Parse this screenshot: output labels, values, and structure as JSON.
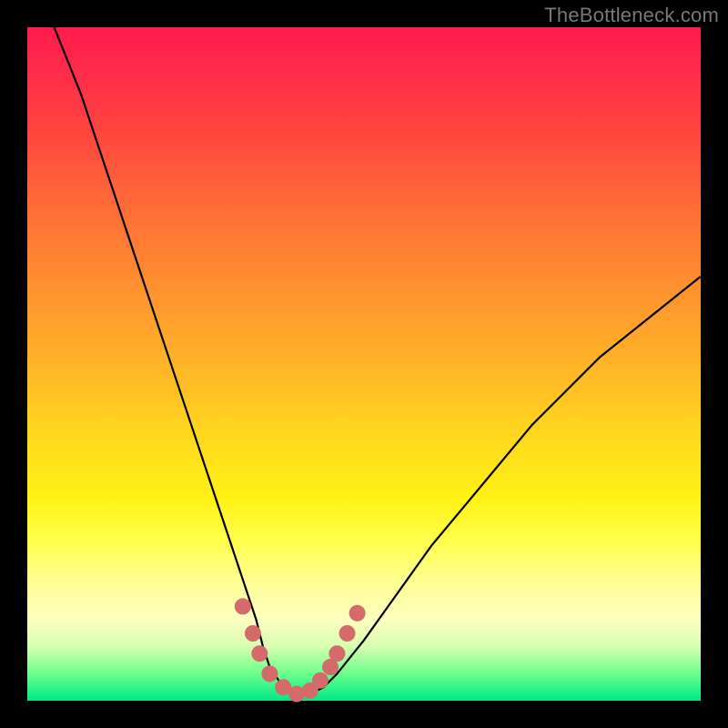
{
  "watermark": "TheBottleneck.com",
  "colors": {
    "frame": "#000000",
    "curve": "#000000",
    "marker": "#d46a6a",
    "gradient_top": "#ff1a4d",
    "gradient_bottom": "#00e887"
  },
  "chart_data": {
    "type": "line",
    "title": "",
    "xlabel": "",
    "ylabel": "",
    "xlim": [
      0,
      100
    ],
    "ylim": [
      0,
      100
    ],
    "annotations": [],
    "series": [
      {
        "name": "bottleneck-curve",
        "x": [
          4,
          8,
          12,
          16,
          20,
          24,
          28,
          30,
          32,
          34,
          35,
          36,
          38,
          40,
          42,
          44,
          46,
          50,
          55,
          60,
          65,
          70,
          75,
          80,
          85,
          90,
          95,
          100
        ],
        "y": [
          100,
          90,
          78,
          66,
          54,
          42,
          30,
          24,
          18,
          12,
          8,
          5,
          2,
          1,
          1,
          2,
          4,
          9,
          16,
          23,
          29,
          35,
          41,
          46,
          51,
          55,
          59,
          63
        ]
      }
    ],
    "markers": {
      "name": "highlight-dots",
      "x": [
        32,
        33.5,
        34.5,
        36,
        38,
        40,
        42,
        43.5,
        45,
        46,
        47.5,
        49
      ],
      "y": [
        14,
        10,
        7,
        4,
        2,
        1,
        1.5,
        3,
        5,
        7,
        10,
        13
      ]
    }
  }
}
